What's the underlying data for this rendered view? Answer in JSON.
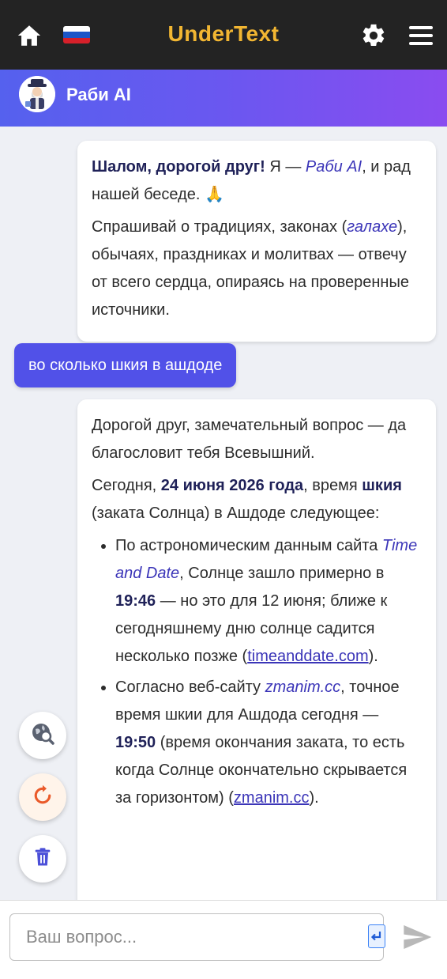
{
  "header": {
    "brand": "UnderText",
    "home_icon": "home-icon",
    "flag": "russia-flag",
    "settings_icon": "gear-icon",
    "menu_icon": "hamburger-menu-icon",
    "brand_color": "#f2b632"
  },
  "bot": {
    "name": "Раби AI",
    "avatar": "rabbi-avatar"
  },
  "messages": {
    "greeting": {
      "bold_1": "Шалом, дорогой друг!",
      "text_1": " Я — ",
      "em_1": "Раби AI",
      "text_2": ", и рад нашей беседе. 🙏",
      "p2_text_1": "Спрашивай о традициях, законах (",
      "p2_em_1": "галахе",
      "p2_text_2": "), обычаях, праздниках и молитвах — отвечу от всего сердца, опираясь на проверенные источники."
    },
    "user_question": "во сколько шкия в ашдоде",
    "answer": {
      "p1": "Дорогой друг, замечательный вопрос — да благословит тебя Всевышний.",
      "p2_text_1": "Сегодня, ",
      "p2_bold_1": "24 июня 2026 года",
      "p2_text_2": ", время ",
      "p2_bold_2": "шкия",
      "p2_text_3": " (заката Солнца) в Ашдоде следующее:",
      "li1_text_1": "По астрономическим данным сайта ",
      "li1_em_1": "Time and Date",
      "li1_text_2": ", Солнце зашло примерно в ",
      "li1_bold_1": "19:46",
      "li1_text_3": " — но это для 12 июня; ближе к сегодняшнему дню солнце садится несколько позже (",
      "li1_link": "timeanddate.com",
      "li1_text_4": ").",
      "li2_text_1": "Согласно веб-сайту ",
      "li2_em_1": "zmanim.cc",
      "li2_text_2": ", точное время шкии для Ашдода сегодня — ",
      "li2_bold_1": "19:50",
      "li2_text_3": " (время окончания заката, то есть когда Солнце окончательно скрывается за горизонтом) (",
      "li2_link": "zmanim.cc",
      "li2_text_4": ")."
    }
  },
  "fabs": {
    "search_icon": "web-search-icon",
    "refresh_icon": "refresh-icon",
    "trash_icon": "trash-icon"
  },
  "composer": {
    "placeholder": "Ваш вопрос...",
    "value": "",
    "send_icon": "send-icon",
    "keyboard_icon": "keyboard-enter-icon"
  },
  "colors": {
    "topbar": "#232323",
    "gradient_start": "#5561ee",
    "gradient_end": "#8a4cf0",
    "user_bubble": "#5151e8",
    "refresh_accent": "#ea5a2a"
  }
}
